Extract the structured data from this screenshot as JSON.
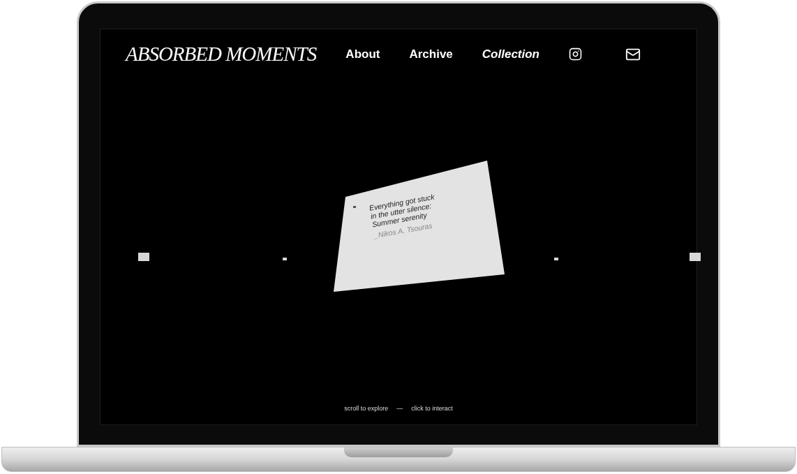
{
  "logo": "ABSORBED MOMENTS",
  "nav": [
    {
      "label": "About",
      "selected": false
    },
    {
      "label": "Archive",
      "selected": false
    },
    {
      "label": "Collection",
      "selected": true
    }
  ],
  "card": {
    "lines": [
      "Everything got stuck",
      "in the utter silence:",
      "Summer serenity"
    ],
    "author": "_Nikos A. Tsouras"
  },
  "hint": {
    "left": "scroll to explore",
    "separator": "—",
    "right": "click to interact"
  }
}
